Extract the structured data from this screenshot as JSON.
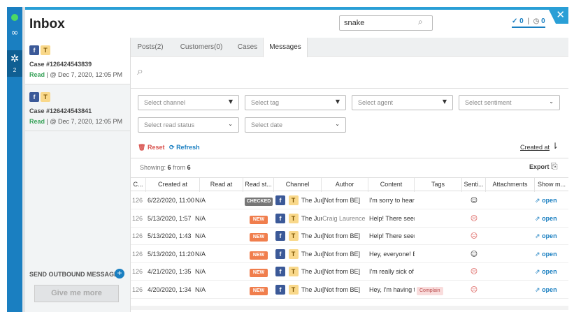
{
  "header": {
    "title": "Inbox",
    "search_value": "snake",
    "checked_count": "0",
    "pending_count": "0"
  },
  "rail": {
    "badge": "2"
  },
  "cases": [
    {
      "id": "Case #126424543839",
      "status": "Read",
      "date": "@ Dec 7, 2020, 12:05 PM"
    },
    {
      "id": "Case #126424543841",
      "status": "Read",
      "date": "@ Dec 7, 2020, 12:05 PM"
    }
  ],
  "sidebar": {
    "outbound_label": "SEND OUTBOUND MESSAGE",
    "give_more_label": "Give me more"
  },
  "tabs": [
    "Posts(2)",
    "Customers(0)",
    "Cases",
    "Messages"
  ],
  "filters": {
    "channel": "Select channel",
    "tag": "Select tag",
    "agent": "Select agent",
    "sentiment": "Select sentiment",
    "read_status": "Select read status",
    "date": "Select date"
  },
  "actions": {
    "reset": "Reset",
    "refresh": "Refresh",
    "created_at": "Created at",
    "export": "Export"
  },
  "showing": {
    "label": "Showing:",
    "count": "6",
    "from_label": "from",
    "total": "6"
  },
  "columns": [
    "C...",
    "Created at",
    "Read at",
    "Read st...",
    "Channel",
    "Author",
    "Content",
    "Tags",
    "Senti...",
    "Attachments",
    "Show m..."
  ],
  "rows": [
    {
      "id": "126",
      "created": "6/22/2020, 11:00",
      "read_at": "N/A",
      "status": "CHECKED",
      "channel_text": "The Jur",
      "author": "[Not from BE]",
      "content": "I'm sorry to hear",
      "tag": "",
      "sentiment": "neutral",
      "open": "open"
    },
    {
      "id": "126",
      "created": "5/13/2020, 1:57",
      "read_at": "N/A",
      "status": "NEW",
      "channel_text": "The Jur",
      "author": "Craig Laurence",
      "content": "Help! There seem",
      "tag": "",
      "sentiment": "negative",
      "open": "open"
    },
    {
      "id": "126",
      "created": "5/13/2020, 1:43",
      "read_at": "N/A",
      "status": "NEW",
      "channel_text": "The Jur",
      "author": "[Not from BE]",
      "content": "Help! There seem",
      "tag": "",
      "sentiment": "negative",
      "open": "open"
    },
    {
      "id": "126",
      "created": "5/13/2020, 11:20",
      "read_at": "N/A",
      "status": "NEW",
      "channel_text": "The Jur",
      "author": "[Not from BE]",
      "content": "Hey, everyone! E",
      "tag": "",
      "sentiment": "neutral",
      "open": "open"
    },
    {
      "id": "126",
      "created": "4/21/2020, 1:35",
      "read_at": "N/A",
      "status": "NEW",
      "channel_text": "The Jur",
      "author": "[Not from BE]",
      "content": "I'm really sick of",
      "tag": "",
      "sentiment": "negative",
      "open": "open"
    },
    {
      "id": "126",
      "created": "4/20/2020, 1:34",
      "read_at": "N/A",
      "status": "NEW",
      "channel_text": "The Jur",
      "author": "[Not from BE]",
      "content": "Hey, I'm having t",
      "tag": "Complain",
      "sentiment": "negative",
      "open": "open"
    }
  ],
  "icons": {
    "fb": "f",
    "tt": "T"
  },
  "colors": {
    "accent": "#1a7fc1",
    "new": "#f07e4d",
    "checked": "#777777",
    "read": "#3aa35b",
    "negative": "#d9534f"
  }
}
